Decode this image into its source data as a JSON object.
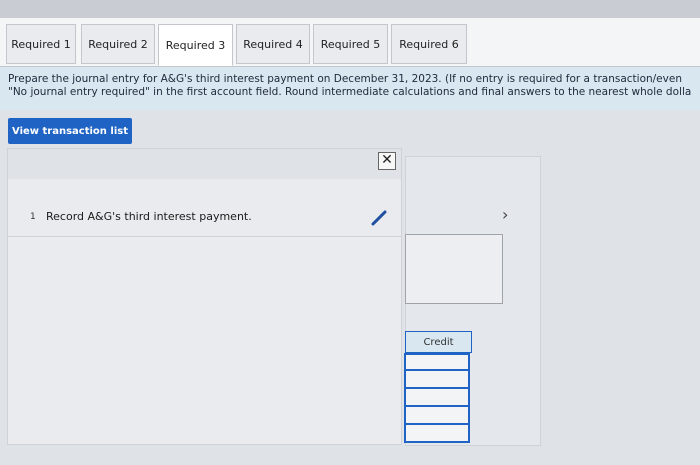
{
  "tabs": [
    {
      "label": "Required 1",
      "active": false
    },
    {
      "label": "Required 2",
      "active": false
    },
    {
      "label": "Required 3",
      "active": true
    },
    {
      "label": "Required 4",
      "active": false
    },
    {
      "label": "Required 5",
      "active": false
    },
    {
      "label": "Required 6",
      "active": false
    }
  ],
  "prompt": {
    "line1": "Prepare the journal entry for A&G's third interest payment on December 31, 2023. (If no entry is required for a transaction/even",
    "line2": "\"No journal entry required\" in the first account field. Round intermediate calculations and final answers to the nearest whole dolla"
  },
  "view_button": {
    "label": "View transaction list"
  },
  "close": {
    "label": "✕"
  },
  "journal": {
    "rows": [
      {
        "number": "1",
        "text": "Record A&G's third interest payment."
      }
    ]
  },
  "nav": {
    "chevron": "›"
  },
  "credit": {
    "header": "Credit"
  },
  "colors": {
    "accent": "#1f63c4",
    "prompt_bg": "#d8e7f0"
  },
  "icons": [
    "close-icon",
    "pencil-icon",
    "chevron-right-icon"
  ]
}
